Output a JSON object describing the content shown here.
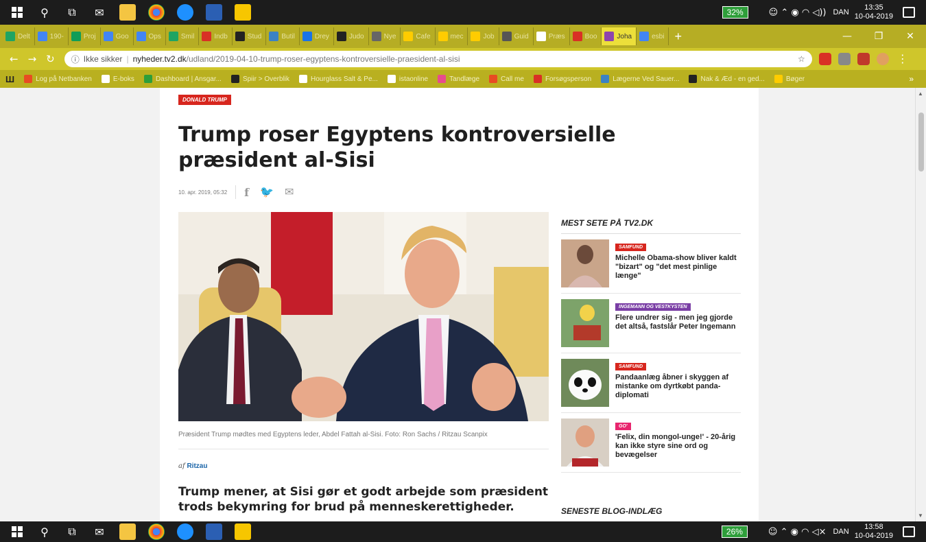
{
  "taskbar_top": {
    "battery": "32%",
    "lang": "DAN",
    "time": "13:35",
    "date": "10-04-2019"
  },
  "taskbar_bottom": {
    "battery": "26%",
    "lang": "DAN",
    "time": "13:58",
    "date": "10-04-2019"
  },
  "tabs": [
    {
      "label": "Delt",
      "color": "#1fa463"
    },
    {
      "label": "190-",
      "color": "#4285f4"
    },
    {
      "label": "Proj",
      "color": "#0f9d58"
    },
    {
      "label": "Goo",
      "color": "#4285f4"
    },
    {
      "label": "Ops",
      "color": "#4285f4"
    },
    {
      "label": "Smil",
      "color": "#1fa463"
    },
    {
      "label": "Indb",
      "color": "#d93025"
    },
    {
      "label": "Stud",
      "color": "#222222"
    },
    {
      "label": "Butil",
      "color": "#3b82c4"
    },
    {
      "label": "Drey",
      "color": "#1a73e8"
    },
    {
      "label": "Judo",
      "color": "#222222"
    },
    {
      "label": "Nye",
      "color": "#666666"
    },
    {
      "label": "Cafe",
      "color": "#ffcc00"
    },
    {
      "label": "mec",
      "color": "#ffcc00"
    },
    {
      "label": "Job",
      "color": "#ffcc00"
    },
    {
      "label": "Guid",
      "color": "#555555"
    },
    {
      "label": "Præs",
      "color": "#ffffff"
    },
    {
      "label": "Boo",
      "color": "#d93025"
    },
    {
      "label": "Joha",
      "color": "#8e44ad"
    },
    {
      "label": "esbi",
      "color": "#4285f4"
    }
  ],
  "nav": {
    "security": "Ikke sikker",
    "url_host": "nyheder.tv2.dk",
    "url_path": "/udland/2019-04-10-trump-roser-egyptens-kontroversielle-praesident-al-sisi"
  },
  "bookmarks": [
    {
      "label": "Log på Netbanken",
      "color": "#e84c22"
    },
    {
      "label": "E-boks",
      "color": "#ffffff"
    },
    {
      "label": "Dashboard | Ansgar...",
      "color": "#2e9e3a"
    },
    {
      "label": "Spiir > Overblik",
      "color": "#222222"
    },
    {
      "label": "Hourglass Salt & Pe...",
      "color": "#ffffff"
    },
    {
      "label": "istaonline",
      "color": "#ffffff"
    },
    {
      "label": "Tandlæge",
      "color": "#e84c8c"
    },
    {
      "label": "Call me",
      "color": "#e84c22"
    },
    {
      "label": "Forsøgsperson",
      "color": "#d93025"
    },
    {
      "label": "Lægerne Ved Sauer...",
      "color": "#3b82c4"
    },
    {
      "label": "Nak & Æd - en ged...",
      "color": "#222222"
    },
    {
      "label": "Bøger",
      "color": "#ffcc00"
    }
  ],
  "article": {
    "tag": "DONALD TRUMP",
    "headline": "Trump roser Egyptens kontroversielle præsident al-Sisi",
    "date": "10. apr. 2019, 05:32",
    "caption": "Præsident Trump mødtes med Egyptens leder, Abdel Fattah al-Sisi. Foto: Ron Sachs / Ritzau Scanpix",
    "byline_prefix": "af",
    "byline_author": "Ritzau",
    "lead": "Trump mener, at Sisi gør et godt arbejde som præsident trods bekymring for brud på menneskerettigheder."
  },
  "sidebar": {
    "title": "MEST SETE PÅ TV2.DK",
    "items": [
      {
        "tag": "SAMFUND",
        "tag_color": "#d7261e",
        "headline": "Michelle Obama-show bliver kaldt \"bizart\" og \"det mest pinlige længe\""
      },
      {
        "tag": "INGEMANN OG VESTKYSTEN",
        "tag_color": "#7a3ea5",
        "headline": "Flere undrer sig - men jeg gjorde det altså, fastslår Peter Ingemann"
      },
      {
        "tag": "SAMFUND",
        "tag_color": "#d7261e",
        "headline": "Pandaanlæg åbner i skyggen af mistanke om dyrtkøbt panda-diplomati"
      },
      {
        "tag": "GO'",
        "tag_color": "#e8266e",
        "headline": "'Felix, din mongol-unge!' - 20-årig kan ikke styre sine ord og bevægelser"
      }
    ],
    "title2": "SENESTE BLOG-INDLÆG"
  }
}
